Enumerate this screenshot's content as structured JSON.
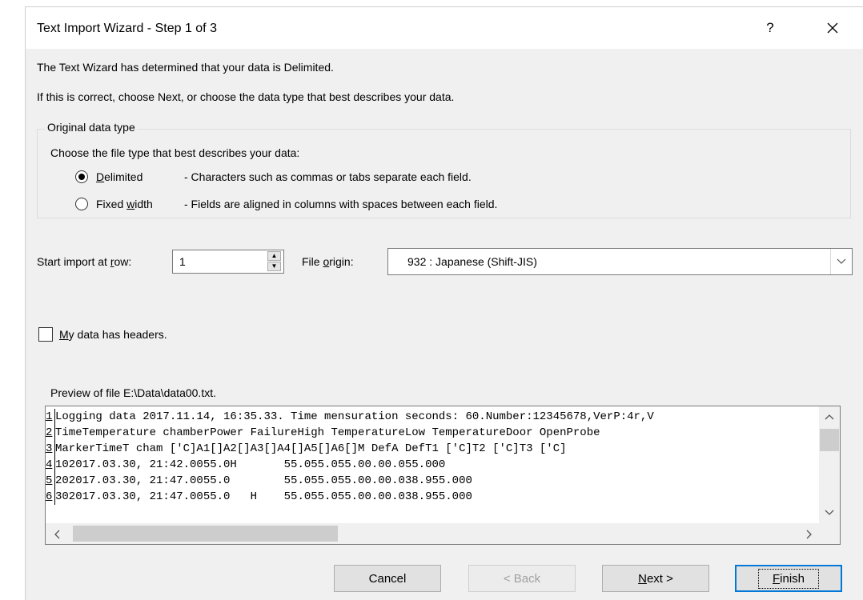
{
  "dialog": {
    "title": "Text Import Wizard - Step 1 of 3",
    "help_label": "?",
    "intro_line1": "The Text Wizard has determined that your data is Delimited.",
    "intro_line2": "If this is correct, choose Next, or choose the data type that best describes your data."
  },
  "original_data_type": {
    "legend": "Original data type",
    "prompt": "Choose the file type that best describes your data:",
    "options": [
      {
        "label_prefix": "",
        "accel": "D",
        "label_suffix": "elimited",
        "description": "- Characters such as commas or tabs separate each field.",
        "selected": true
      },
      {
        "label_prefix": "Fixed ",
        "accel": "w",
        "label_suffix": "idth",
        "description": "- Fields are aligned in columns with spaces between each field.",
        "selected": false
      }
    ]
  },
  "start_row": {
    "label_prefix": "Start import at ",
    "label_accel": "r",
    "label_suffix": "ow:",
    "value": "1"
  },
  "file_origin": {
    "label_prefix": "File ",
    "label_accel": "o",
    "label_suffix": "rigin:",
    "value": "932 : Japanese (Shift-JIS)"
  },
  "headers_checkbox": {
    "label_accel": "M",
    "label_suffix": "y data has headers.",
    "checked": false
  },
  "preview": {
    "label": "Preview of file E:\\Data\\data00.txt.",
    "lines": [
      {
        "num": "1",
        "text": "Logging data 2017.11.14, 16:35.33. Time mensuration seconds: 60.Number:12345678,VerP:4r,V"
      },
      {
        "num": "2",
        "text": "TimeTemperature chamberPower FailureHigh TemperatureLow TemperatureDoor OpenProbe"
      },
      {
        "num": "3",
        "text": "MarkerTimeT cham ['C]A1[]A2[]A3[]A4[]A5[]A6[]M DefA DefT1 ['C]T2 ['C]T3 ['C]"
      },
      {
        "num": "4",
        "text": "102017.03.30, 21:42.0055.0H       55.055.055.00.00.055.000"
      },
      {
        "num": "5",
        "text": "202017.03.30, 21:47.0055.0        55.055.055.00.00.038.955.000"
      },
      {
        "num": "6",
        "text": "302017.03.30, 21:47.0055.0   H    55.055.055.00.00.038.955.000"
      }
    ]
  },
  "buttons": {
    "cancel": "Cancel",
    "back": "< Back",
    "next_accel": "N",
    "next_suffix": "ext >",
    "finish_accel": "F",
    "finish_suffix": "inish"
  },
  "icons": {
    "close": "close-icon",
    "spin_up": "triangle-up-icon",
    "spin_down": "triangle-down-icon",
    "dropdown": "chevron-down-icon",
    "scroll_up": "chevron-up-icon",
    "scroll_down": "chevron-down-icon",
    "scroll_left": "chevron-left-icon",
    "scroll_right": "chevron-right-icon"
  }
}
